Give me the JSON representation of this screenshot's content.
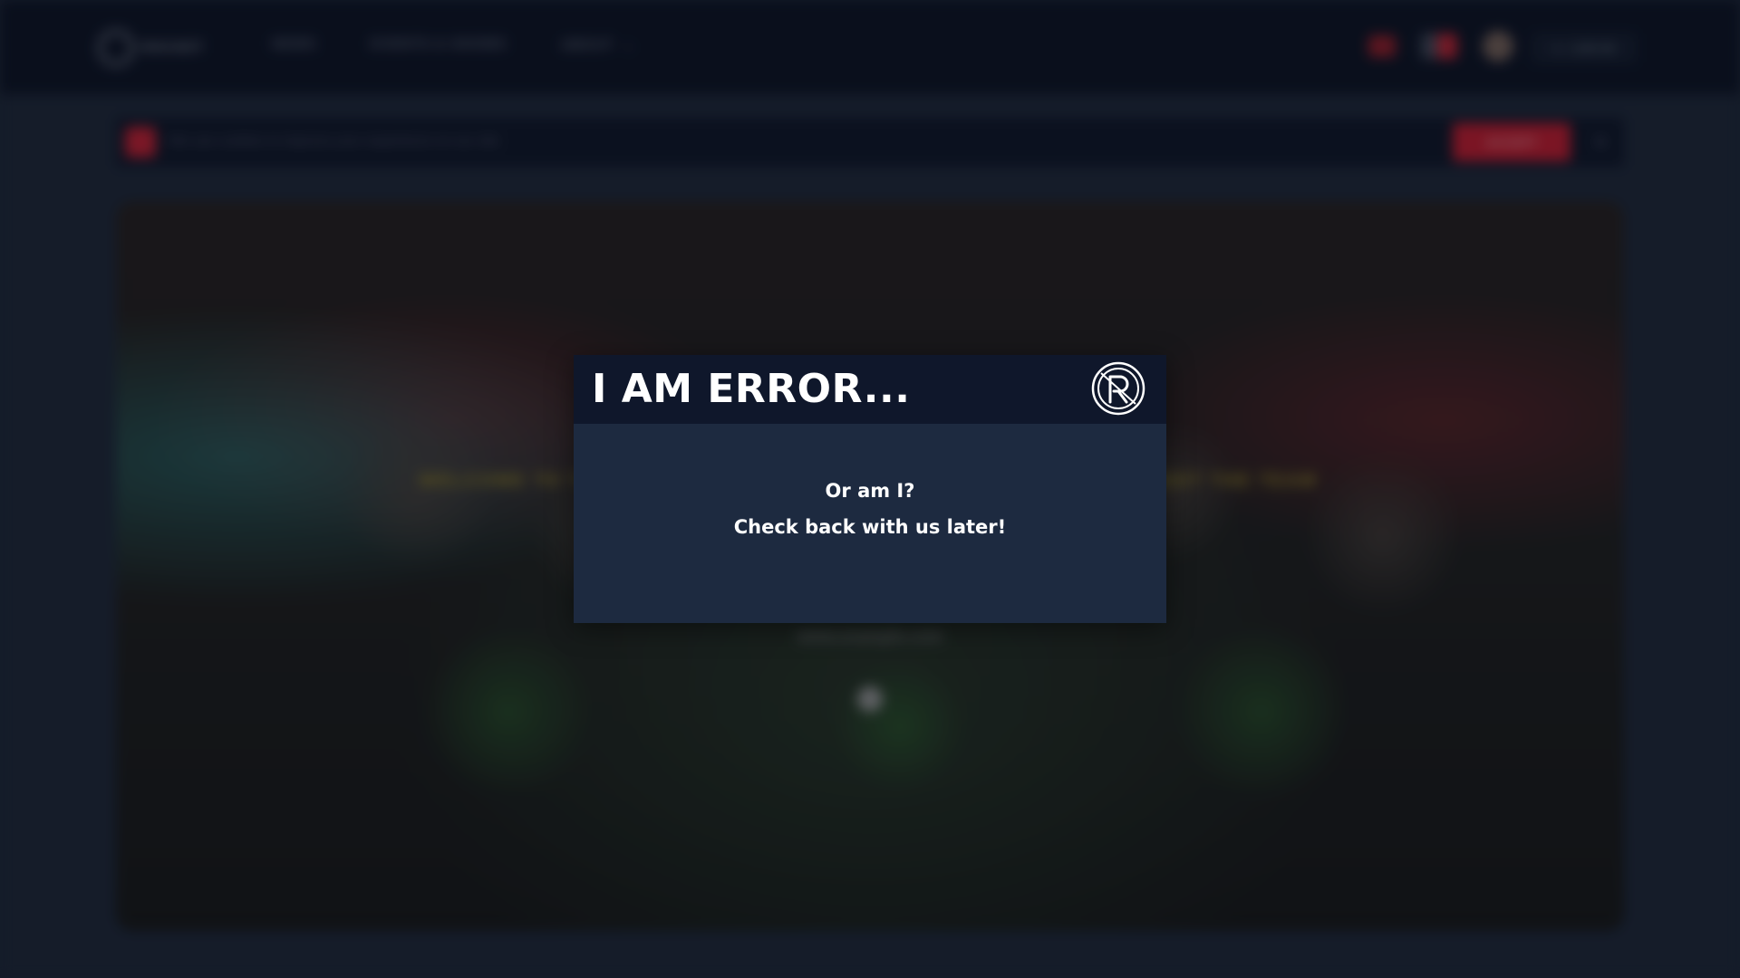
{
  "background": {
    "nav": {
      "logo_text": "ROCKET",
      "items": [
        {
          "label": "NEWS"
        },
        {
          "label": "EVENTS & SHOWS"
        },
        {
          "label": "ABOUT",
          "has_dropdown": true
        }
      ],
      "login_label": "LOG IN"
    },
    "notice": {
      "text": "We use cookies to improve your experience on our site",
      "button_label": "ACCEPT",
      "close_glyph": "×"
    },
    "hero": {
      "headline": "WELCOME TO THE COMMUNITY — JOIN US AT OUR NEXT EVENT AND MEET THE TEAM",
      "subtitle": "www.example.com"
    }
  },
  "modal": {
    "title": "I AM ERROR...",
    "logo_icon": "circled-r-logo-icon",
    "line1": "Or am I?",
    "line2": "Check back with us later!"
  },
  "colors": {
    "modal_header": "#0f172b",
    "modal_body": "#1d2a40",
    "accent_red": "#b8192b",
    "page_bg": "#1c2434"
  }
}
